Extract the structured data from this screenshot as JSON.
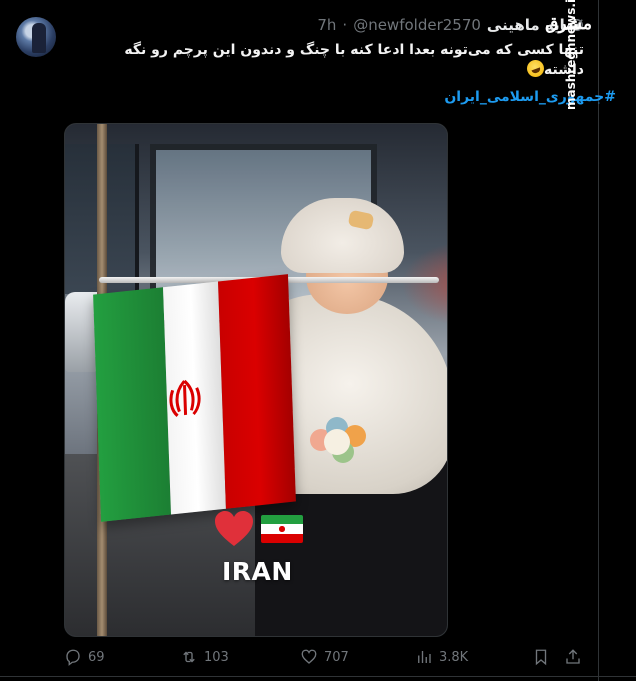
{
  "tweet": {
    "display_name": "سایه ماهینی",
    "handle": "@newfolder2570",
    "separator": "·",
    "time": "7h",
    "text": "تنها کسی که می‌تونه بعدا ادعا کنه با چنگ و دندون این پرچم رو نگه داشته",
    "hashtag": "#جمهوری_اسلامی_ایران"
  },
  "media": {
    "caption": "IRAN",
    "emoji": [
      "heart-emoji",
      "iran-flag-emoji"
    ],
    "colors": {
      "green": "#239f40",
      "white": "#ffffff",
      "red": "#da0000"
    }
  },
  "actions": {
    "replies": "69",
    "reposts": "103",
    "likes": "707",
    "views": "3.8K"
  },
  "watermark": {
    "logo_text": "مشرق",
    "site": "mashreghnews.ir"
  },
  "colors": {
    "background": "#000000",
    "text": "#e7e9ea",
    "muted": "#71767b",
    "link": "#1d9bf0",
    "border": "#2f3336"
  }
}
